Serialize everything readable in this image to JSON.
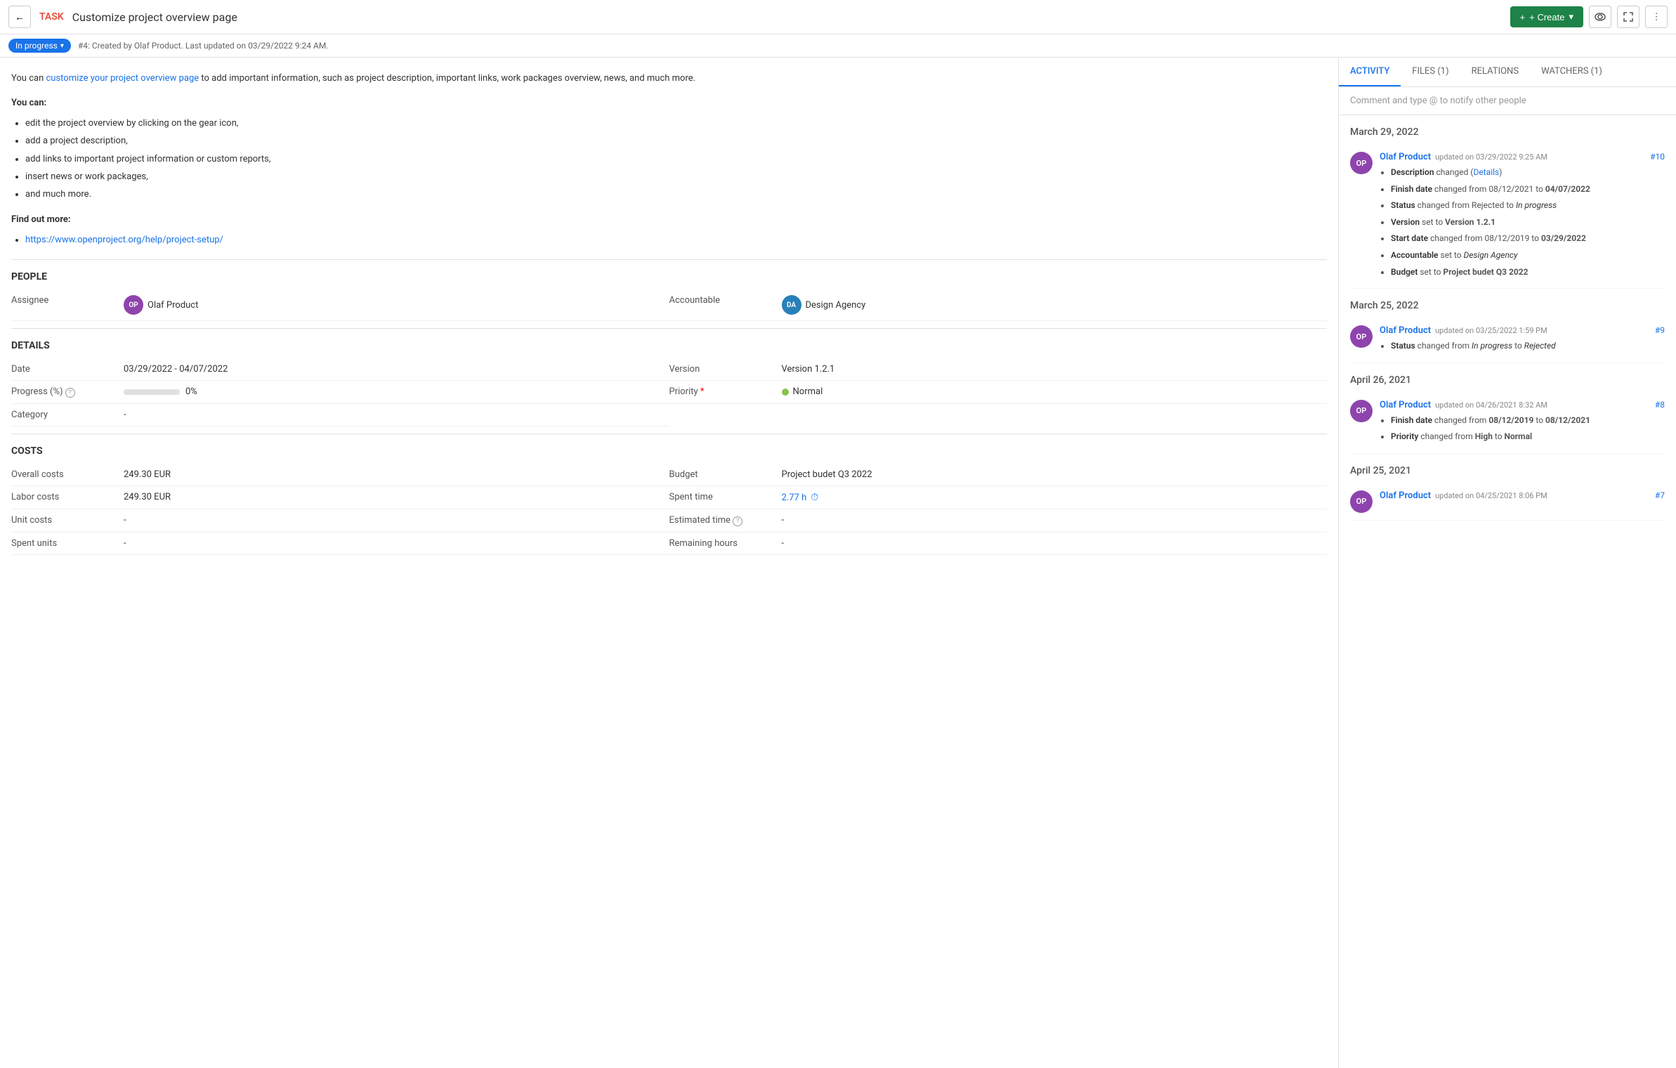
{
  "header": {
    "back_label": "←",
    "task_label": "TASK",
    "task_title": "Customize project overview page",
    "create_button": "+ Create",
    "create_arrow": "▾"
  },
  "subheader": {
    "status": "In progress",
    "meta": "#4: Created by Olaf Product. Last updated on 03/29/2022 9:24 AM."
  },
  "description": {
    "intro_pre": "You can ",
    "intro_link": "customize your project overview page",
    "intro_post": " to add important information, such as project description, important links, work packages overview, news, and much more.",
    "you_can_label": "You can:",
    "bullets": [
      "edit the project overview by clicking on the gear icon,",
      "add a project description,",
      "add links to important project information or custom reports,",
      "insert news or work packages,",
      "and much more."
    ],
    "find_out_label": "Find out more:",
    "link": "https://www.openproject.org/help/project-setup/"
  },
  "people": {
    "section_label": "PEOPLE",
    "assignee_label": "Assignee",
    "assignee_value": "Olaf Product",
    "assignee_initials": "OP",
    "accountable_label": "Accountable",
    "accountable_value": "Design Agency",
    "accountable_initials": "DA"
  },
  "details": {
    "section_label": "DETAILS",
    "date_label": "Date",
    "date_value": "03/29/2022 - 04/07/2022",
    "version_label": "Version",
    "version_value": "Version 1.2.1",
    "progress_label": "Progress (%)",
    "progress_value": "0%",
    "priority_label": "Priority",
    "priority_value": "Normal",
    "category_label": "Category",
    "category_value": "-"
  },
  "costs": {
    "section_label": "COSTS",
    "overall_costs_label": "Overall costs",
    "overall_costs_value": "249.30 EUR",
    "budget_label": "Budget",
    "budget_value": "Project budet Q3 2022",
    "labor_costs_label": "Labor costs",
    "labor_costs_value": "249.30 EUR",
    "spent_time_label": "Spent time",
    "spent_time_value": "2.77 h",
    "unit_costs_label": "Unit costs",
    "unit_costs_value": "-",
    "estimated_time_label": "Estimated time",
    "estimated_time_value": "-",
    "spent_units_label": "Spent units",
    "spent_units_value": "-",
    "remaining_hours_label": "Remaining hours",
    "remaining_hours_value": "-"
  },
  "tabs": {
    "activity": "ACTIVITY",
    "files": "FILES (1)",
    "relations": "RELATIONS",
    "watchers": "WATCHERS (1)"
  },
  "comment_placeholder": "Comment and type @ to notify other people",
  "activity": {
    "dates": [
      {
        "date": "March 29, 2022",
        "items": [
          {
            "user": "Olaf Product",
            "initials": "OP",
            "time": "updated on 03/29/2022 9:25 AM",
            "number": "#10",
            "changes": [
              {
                "field": "Description",
                "text": " changed (",
                "link": "Details",
                "after": ")"
              },
              {
                "field": "Finish date",
                "text": " changed from ",
                "from": "08/12/2021",
                "to": "04/07/2022"
              },
              {
                "field": "Status",
                "text": " changed from ",
                "from": "Rejected",
                "to": "In progress",
                "italic_to": true
              },
              {
                "field": "Version",
                "text": " set to ",
                "set": "Version 1.2.1"
              },
              {
                "field": "Start date",
                "text": " changed from ",
                "from": "08/12/2019",
                "to": "03/29/2022"
              },
              {
                "field": "Accountable",
                "text": " set to ",
                "set": "Design Agency",
                "italic_set": true
              },
              {
                "field": "Budget",
                "text": " set to ",
                "set": "Project budet Q3 2022"
              }
            ]
          }
        ]
      },
      {
        "date": "March 25, 2022",
        "items": [
          {
            "user": "Olaf Product",
            "initials": "OP",
            "time": "updated on 03/25/2022 1:59 PM",
            "number": "#9",
            "changes": [
              {
                "field": "Status",
                "text": " changed from ",
                "from": "In progress",
                "italic_from": true,
                "to": "Rejected",
                "italic_to": true
              }
            ]
          }
        ]
      },
      {
        "date": "April 26, 2021",
        "items": [
          {
            "user": "Olaf Product",
            "initials": "OP",
            "time": "updated on 04/26/2021 8:32 AM",
            "number": "#8",
            "changes": [
              {
                "field": "Finish date",
                "text": " changed from ",
                "from": "08/12/2019",
                "to": "08/12/2021"
              },
              {
                "field": "Priority",
                "text": " changed from ",
                "from": "High",
                "bold_from": true,
                "to": "Normal",
                "bold_to": true
              }
            ]
          }
        ]
      },
      {
        "date": "April 25, 2021",
        "items": [
          {
            "user": "Olaf Product",
            "initials": "OP",
            "time": "updated on 04/25/2021 8:06 PM",
            "number": "#7",
            "changes": []
          }
        ]
      }
    ]
  }
}
